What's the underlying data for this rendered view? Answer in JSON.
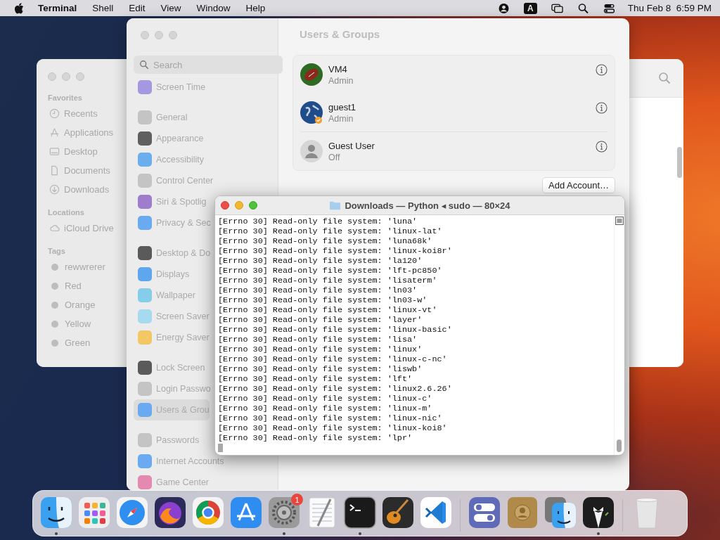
{
  "menu_bar": {
    "app": "Terminal",
    "menus": [
      "Shell",
      "Edit",
      "View",
      "Window",
      "Help"
    ],
    "input_badge": "A",
    "clock": "Thu Feb 8  6:59 PM"
  },
  "finder": {
    "sections": [
      {
        "heading": "Favorites",
        "items": [
          {
            "label": "Recents",
            "kind": "clock"
          },
          {
            "label": "Applications",
            "kind": "apps"
          },
          {
            "label": "Desktop",
            "kind": "desktop"
          },
          {
            "label": "Documents",
            "kind": "document"
          },
          {
            "label": "Downloads",
            "kind": "download"
          }
        ]
      },
      {
        "heading": "Locations",
        "items": [
          {
            "label": "iCloud Drive",
            "kind": "cloud"
          }
        ]
      },
      {
        "heading": "Tags",
        "items": [
          {
            "label": "rewwrerer",
            "kind": "tag"
          },
          {
            "label": "Red",
            "kind": "tag"
          },
          {
            "label": "Orange",
            "kind": "tag"
          },
          {
            "label": "Yellow",
            "kind": "tag"
          },
          {
            "label": "Green",
            "kind": "tag"
          }
        ]
      }
    ]
  },
  "settings": {
    "search": {
      "placeholder": "Search"
    },
    "groups": [
      [
        {
          "label": "Screen Time",
          "color": "#a597e0",
          "selected": false
        }
      ],
      [
        {
          "label": "General",
          "color": "#c4c4c4",
          "selected": false
        },
        {
          "label": "Appearance",
          "color": "#606060",
          "selected": false
        },
        {
          "label": "Accessibility",
          "color": "#6aaeee",
          "selected": false
        },
        {
          "label": "Control Center",
          "color": "#c4c4c4",
          "selected": false
        },
        {
          "label": "Siri & Spotlig",
          "color": "#a07ccc",
          "selected": false
        },
        {
          "label": "Privacy & Sec",
          "color": "#6aaaf0",
          "selected": false
        }
      ],
      [
        {
          "label": "Desktop & Do",
          "color": "#5a5a5a",
          "selected": false
        },
        {
          "label": "Displays",
          "color": "#5ea6ee",
          "selected": false
        },
        {
          "label": "Wallpaper",
          "color": "#86cdea",
          "selected": false
        },
        {
          "label": "Screen Saver",
          "color": "#a6daee",
          "selected": false
        },
        {
          "label": "Energy Saver",
          "color": "#f3c766",
          "selected": false
        }
      ],
      [
        {
          "label": "Lock Screen",
          "color": "#5a5a5a",
          "selected": false
        },
        {
          "label": "Login Passwo",
          "color": "#c4c4c4",
          "selected": false
        },
        {
          "label": "Users & Grou",
          "color": "#6aaaf0",
          "selected": true
        }
      ],
      [
        {
          "label": "Passwords",
          "color": "#c4c4c4",
          "selected": false
        },
        {
          "label": "Internet Accounts",
          "color": "#6aaaf0",
          "selected": false
        },
        {
          "label": "Game Center",
          "color": "#e489b0",
          "selected": false
        }
      ]
    ],
    "title": "Users & Groups",
    "users": [
      {
        "name": "VM4",
        "role": "Admin",
        "kind": "ball"
      },
      {
        "name": "guest1",
        "role": "Admin",
        "kind": "globe"
      },
      {
        "name": "Guest User",
        "role": "Off",
        "kind": "silhouette"
      }
    ],
    "add_button": "Add Account…"
  },
  "terminal": {
    "title": "Downloads — Python ◂ sudo — 80×24",
    "lines": [
      "[Errno 30] Read-only file system: 'luna'",
      "[Errno 30] Read-only file system: 'linux-lat'",
      "[Errno 30] Read-only file system: 'luna68k'",
      "[Errno 30] Read-only file system: 'linux-koi8r'",
      "[Errno 30] Read-only file system: 'la120'",
      "[Errno 30] Read-only file system: 'lft-pc850'",
      "[Errno 30] Read-only file system: 'lisaterm'",
      "[Errno 30] Read-only file system: 'ln03'",
      "[Errno 30] Read-only file system: 'ln03-w'",
      "[Errno 30] Read-only file system: 'linux-vt'",
      "[Errno 30] Read-only file system: 'layer'",
      "[Errno 30] Read-only file system: 'linux-basic'",
      "[Errno 30] Read-only file system: 'lisa'",
      "[Errno 30] Read-only file system: 'linux'",
      "[Errno 30] Read-only file system: 'linux-c-nc'",
      "[Errno 30] Read-only file system: 'liswb'",
      "[Errno 30] Read-only file system: 'lft'",
      "[Errno 30] Read-only file system: 'linux2.6.26'",
      "[Errno 30] Read-only file system: 'linux-c'",
      "[Errno 30] Read-only file system: 'linux-m'",
      "[Errno 30] Read-only file system: 'linux-nic'",
      "[Errno 30] Read-only file system: 'linux-koi8'",
      "[Errno 30] Read-only file system: 'lpr'"
    ]
  },
  "dock": {
    "sections": [
      [
        {
          "kind": "face",
          "running": true
        },
        {
          "kind": "grid",
          "running": false
        },
        {
          "kind": "compass",
          "running": false
        },
        {
          "kind": "fox",
          "running": false
        },
        {
          "kind": "wheel",
          "running": false
        },
        {
          "kind": "letter",
          "running": false
        },
        {
          "kind": "gear",
          "running": true,
          "badge": "1"
        },
        {
          "kind": "notepad",
          "running": false
        },
        {
          "kind": "terminal",
          "running": true
        },
        {
          "kind": "guitar",
          "running": false
        },
        {
          "kind": "code",
          "running": false
        }
      ],
      [
        {
          "kind": "toggles",
          "running": false
        },
        {
          "kind": "contacts",
          "running": false
        },
        {
          "kind": "faces",
          "running": false
        },
        {
          "kind": "tuxedo",
          "running": true
        }
      ],
      [
        {
          "kind": "trash",
          "running": false
        }
      ]
    ]
  }
}
